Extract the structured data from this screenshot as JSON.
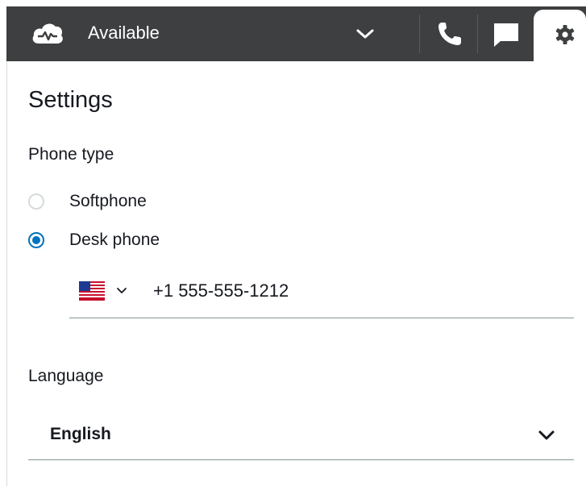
{
  "status": {
    "label": "Available",
    "icon": "cloud-status-icon"
  },
  "toolbar": {
    "phone_icon": "phone-icon",
    "chat_icon": "chat-icon",
    "settings_icon": "gear-icon"
  },
  "settings": {
    "title": "Settings",
    "phone_type_label": "Phone type",
    "options": [
      {
        "label": "Softphone",
        "selected": false
      },
      {
        "label": "Desk phone",
        "selected": true
      }
    ],
    "phone_number": "+1 555-555-1212",
    "country_flag": "US",
    "language_label": "Language",
    "language_value": "English"
  },
  "colors": {
    "topbar": "#3e3f40",
    "accent": "#0073bb",
    "text": "#16191f"
  }
}
